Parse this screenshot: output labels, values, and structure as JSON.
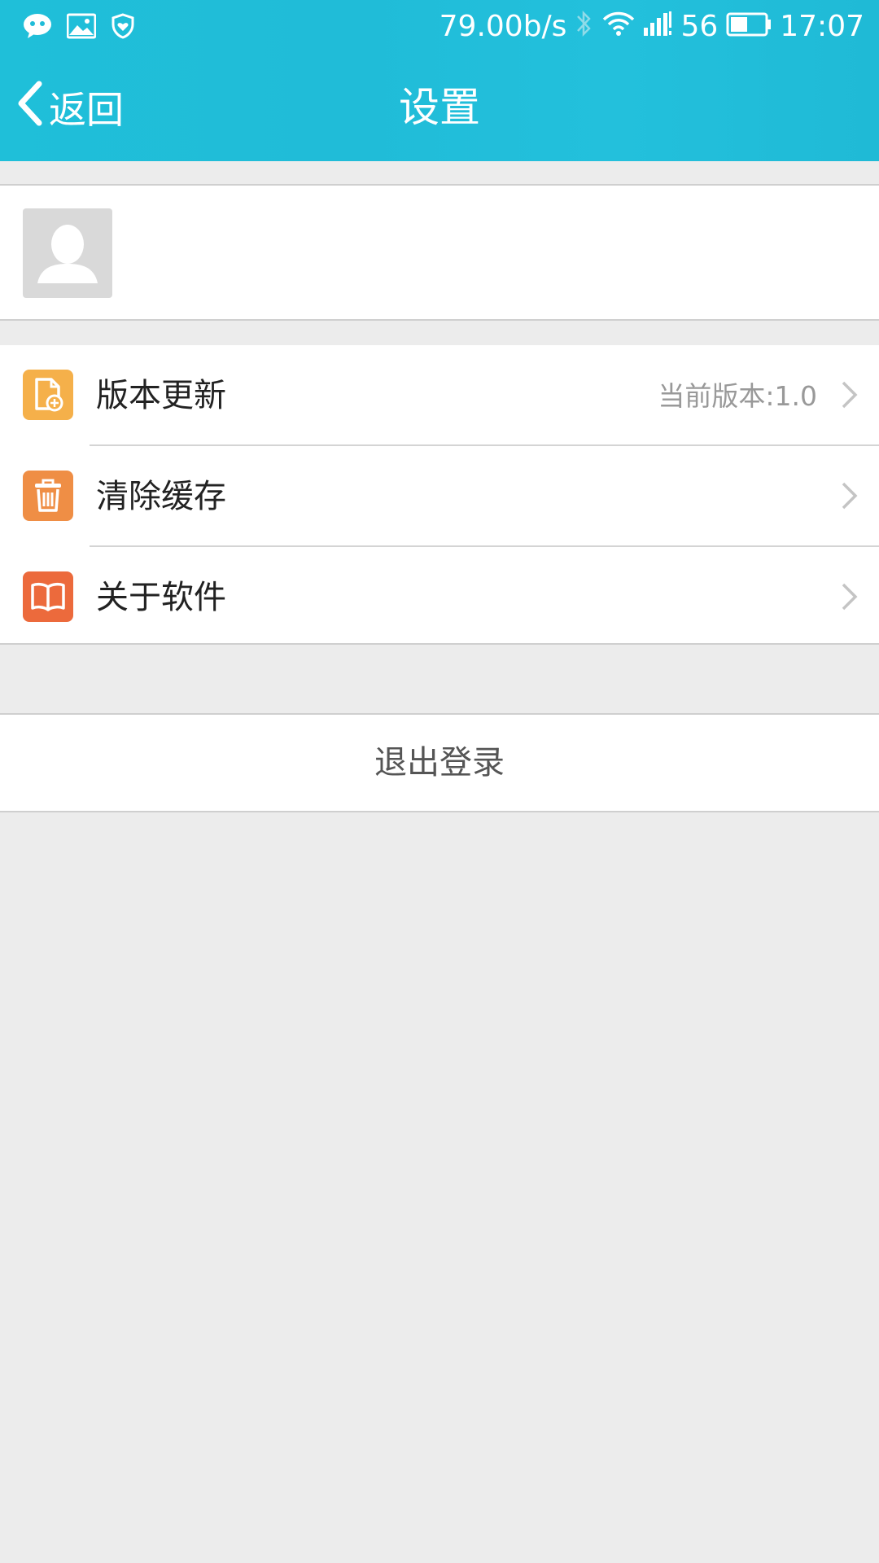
{
  "status_bar": {
    "network_speed": "79.00b/s",
    "signal_text": "56",
    "time": "17:07",
    "icons_left": [
      "chat-bubble-icon",
      "image-icon",
      "shield-heart-icon"
    ],
    "icons_right": [
      "bluetooth-icon",
      "wifi-icon",
      "cellular-signal-icon",
      "battery-icon"
    ]
  },
  "nav": {
    "back_label": "返回",
    "title": "设置"
  },
  "profile": {
    "avatar_icon": "avatar-placeholder-icon"
  },
  "settings": {
    "items": [
      {
        "label": "版本更新",
        "value": "当前版本:1.0",
        "icon": "file-update-icon",
        "color": "#f5b04a"
      },
      {
        "label": "清除缓存",
        "value": "",
        "icon": "trash-icon",
        "color": "#ef8e45"
      },
      {
        "label": "关于软件",
        "value": "",
        "icon": "book-icon",
        "color": "#ec6a3c"
      }
    ]
  },
  "logout": {
    "label": "退出登录"
  },
  "colors": {
    "header": "#20bcd8",
    "background": "#ececec"
  }
}
